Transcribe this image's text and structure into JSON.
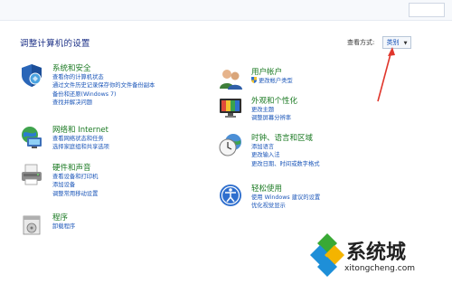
{
  "header": {
    "title": "调整计算机的设置",
    "view_by_label": "查看方式:",
    "view_by_value": "类别"
  },
  "categories": [
    {
      "title": "系统和安全",
      "icon": "shield-icon",
      "links": [
        "查看你的计算机状态",
        "通过文件历史记录保存你的文件备份副本",
        "备份和还原(Windows 7)",
        "查找并解决问题"
      ]
    },
    {
      "title": "网络和 Internet",
      "icon": "network-globe-icon",
      "links": [
        "查看网络状态和任务",
        "选择家庭组和共享选项"
      ]
    },
    {
      "title": "硬件和声音",
      "icon": "printer-icon",
      "links": [
        "查看设备和打印机",
        "添加设备",
        "调整常用移动设置"
      ]
    },
    {
      "title": "程序",
      "icon": "programs-icon",
      "links": [
        "卸载程序"
      ]
    },
    {
      "title": "用户帐户",
      "icon": "users-icon",
      "links": [
        "更改帐户类型"
      ]
    },
    {
      "title": "外观和个性化",
      "icon": "monitor-icon",
      "links": [
        "更改主题",
        "调整屏幕分辨率"
      ]
    },
    {
      "title": "时钟、语言和区域",
      "icon": "clock-globe-icon",
      "links": [
        "添加语言",
        "更改输入法",
        "更改日期、时间或数字格式"
      ]
    },
    {
      "title": "轻松使用",
      "icon": "accessibility-icon",
      "links": [
        "使用 Windows 建议的设置",
        "优化视觉显示"
      ]
    }
  ],
  "watermark": {
    "brand": "系统城",
    "url": "xitongcheng.com"
  },
  "colors": {
    "title": "#1e3287",
    "category_title": "#1b7a23",
    "link": "#1a55b8",
    "annotation_arrow": "#e0362c"
  }
}
